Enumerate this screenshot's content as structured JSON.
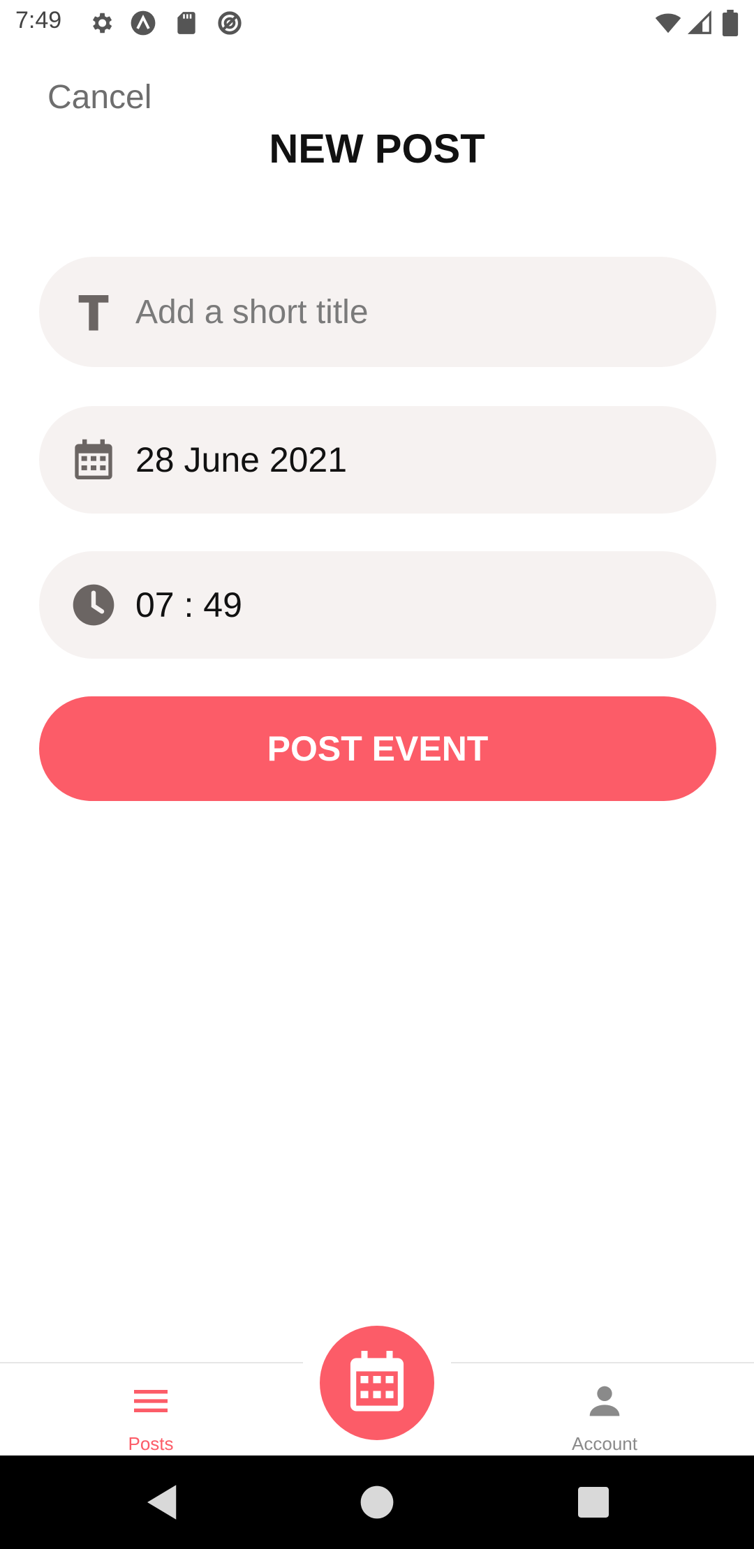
{
  "status_bar": {
    "time": "7:49",
    "left_icons": [
      "settings-icon",
      "app-notification-icon",
      "sd-card-icon",
      "data-saver-icon"
    ],
    "right_icons": [
      "wifi-icon",
      "cell-signal-icon",
      "battery-icon"
    ]
  },
  "header": {
    "cancel_label": "Cancel",
    "title": "NEW POST"
  },
  "form": {
    "title_field": {
      "icon": "text-format-icon",
      "placeholder": "Add a short title",
      "value": ""
    },
    "date_field": {
      "icon": "calendar-icon",
      "value": "28 June 2021"
    },
    "time_field": {
      "icon": "clock-icon",
      "value": "07 : 49"
    },
    "submit_label": "POST EVENT"
  },
  "tab_bar": {
    "tabs": [
      {
        "label": "Posts",
        "icon": "menu-icon",
        "active": true
      },
      {
        "label": "Account",
        "icon": "person-icon",
        "active": false
      }
    ],
    "fab_icon": "calendar-icon"
  },
  "nav_bar": {
    "buttons": [
      "back-icon",
      "home-icon",
      "recents-icon"
    ]
  },
  "colors": {
    "accent": "#fc5c68",
    "field_background": "#f6f2f1",
    "text_primary": "#111111",
    "text_secondary": "#7a7a7a"
  }
}
